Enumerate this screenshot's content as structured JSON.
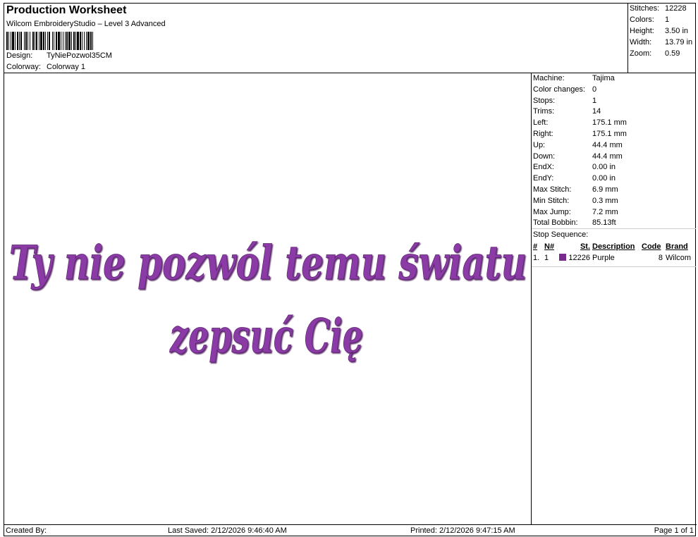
{
  "header": {
    "title": "Production Worksheet",
    "subtitle": "Wilcom EmbroideryStudio – Level 3 Advanced",
    "design_label": "Design:",
    "design_value": "TyNiePozwol35CM",
    "colorway_label": "Colorway:",
    "colorway_value": "Colorway 1"
  },
  "stats": {
    "stitches_label": "Stitches:",
    "stitches_value": "12228",
    "colors_label": "Colors:",
    "colors_value": "1",
    "height_label": "Height:",
    "height_value": "3.50 in",
    "width_label": "Width:",
    "width_value": "13.79 in",
    "zoom_label": "Zoom:",
    "zoom_value": "0.59"
  },
  "machine_info": [
    {
      "label": "Machine:",
      "value": "Tajima"
    },
    {
      "label": "Color changes:",
      "value": "0"
    },
    {
      "label": "Stops:",
      "value": "1"
    },
    {
      "label": "Trims:",
      "value": "14"
    },
    {
      "label": "Left:",
      "value": "175.1 mm"
    },
    {
      "label": "Right:",
      "value": "175.1 mm"
    },
    {
      "label": "Up:",
      "value": "44.4 mm"
    },
    {
      "label": "Down:",
      "value": "44.4 mm"
    },
    {
      "label": "EndX:",
      "value": "0.00 in"
    },
    {
      "label": "EndY:",
      "value": "0.00 in"
    },
    {
      "label": "Max Stitch:",
      "value": "6.9 mm"
    },
    {
      "label": "Min Stitch:",
      "value": "0.3 mm"
    },
    {
      "label": "Max Jump:",
      "value": "7.2 mm"
    },
    {
      "label": "Total Bobbin:",
      "value": "85.13ft"
    }
  ],
  "stop_sequence": {
    "title": "Stop Sequence:",
    "headers": {
      "num": "#",
      "n": "N#",
      "st": "St.",
      "description": "Description",
      "code": "Code",
      "brand": "Brand"
    },
    "rows": [
      {
        "num": "1.",
        "n": "1",
        "color": "#7a2a8c",
        "st": "12226",
        "description": "Purple",
        "code": "8",
        "brand": "Wilcom"
      }
    ]
  },
  "design": {
    "line1": "Ty nie pozwól temu światu",
    "line2": "zepsuć Cię",
    "thread_color": "#8b3aa6",
    "shadow_color": "#5a1f6e"
  },
  "footer": {
    "created_by": "Created By:",
    "last_saved": "Last Saved: 2/12/2026 9:46:40 AM",
    "printed": "Printed: 2/12/2026 9:47:15 AM",
    "page": "Page 1 of 1"
  }
}
